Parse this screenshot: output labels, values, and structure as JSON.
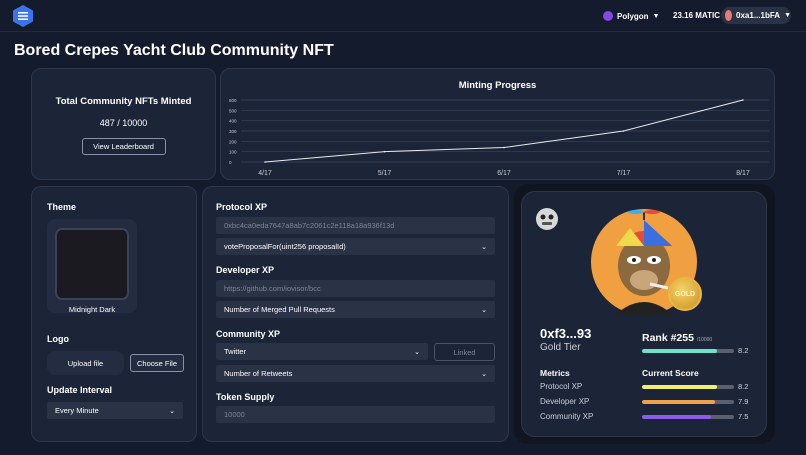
{
  "header": {
    "network": "Polygon",
    "balance": "23.16 MATIC",
    "account": "0xa1...1bFA"
  },
  "page_title": "Bored Crepes Yacht Club Community NFT",
  "total": {
    "title": "Total Community NFTs Minted",
    "value": "487 / 10000",
    "progress": 0.0487,
    "button": "View Leaderboard"
  },
  "chart_data": {
    "type": "line",
    "title": "Minting Progress",
    "x": [
      "4/17",
      "5/17",
      "6/17",
      "7/17",
      "8/17"
    ],
    "y_ticks": [
      "600",
      "500",
      "400",
      "300",
      "200",
      "100",
      "0"
    ],
    "ylim": [
      0,
      600
    ],
    "values": [
      0,
      100,
      140,
      300,
      600
    ],
    "grid": true
  },
  "theme": {
    "label": "Theme",
    "selected": "Midnight Dark",
    "swatch_color": "#1a1a20"
  },
  "logo": {
    "label": "Logo",
    "upload": "Upload file",
    "choose": "Choose File"
  },
  "interval": {
    "label": "Update Interval",
    "value": "Every Minute"
  },
  "protocol_xp": {
    "label": "Protocol XP",
    "address_placeholder": "0xbc4ca0eda7647a8ab7c2061c2e118a18a936f13d",
    "function": "voteProposalFor(uint256 proposalId)"
  },
  "developer_xp": {
    "label": "Developer XP",
    "repo_placeholder": "https://github.com/iovisor/bcc",
    "metric": "Number of Merged Pull Requests"
  },
  "community_xp": {
    "label": "Community XP",
    "platform": "Twitter",
    "linked": "Linked",
    "metric": "Number of Retweets"
  },
  "token_supply": {
    "label": "Token Supply",
    "placeholder": "10000"
  },
  "nft": {
    "address": "0xf3...93",
    "tier": "Gold Tier",
    "rank": "Rank #255",
    "rank_total": "/10000",
    "badge": "GOLD",
    "score_value": "8.2",
    "score_fill": 0.82,
    "metrics_label": "Metrics",
    "current_label": "Current Score",
    "metrics": [
      {
        "name": "Protocol XP",
        "value": "8.2",
        "fill": 0.82,
        "color": "#f2ee6b"
      },
      {
        "name": "Developer XP",
        "value": "7.9",
        "fill": 0.79,
        "color": "#f0a24a"
      },
      {
        "name": "Community XP",
        "value": "7.5",
        "fill": 0.75,
        "color": "#8a5ce8"
      }
    ]
  },
  "colors": {
    "accent": "#6de3c8",
    "background": "#141b2d",
    "card": "#1c2538"
  }
}
